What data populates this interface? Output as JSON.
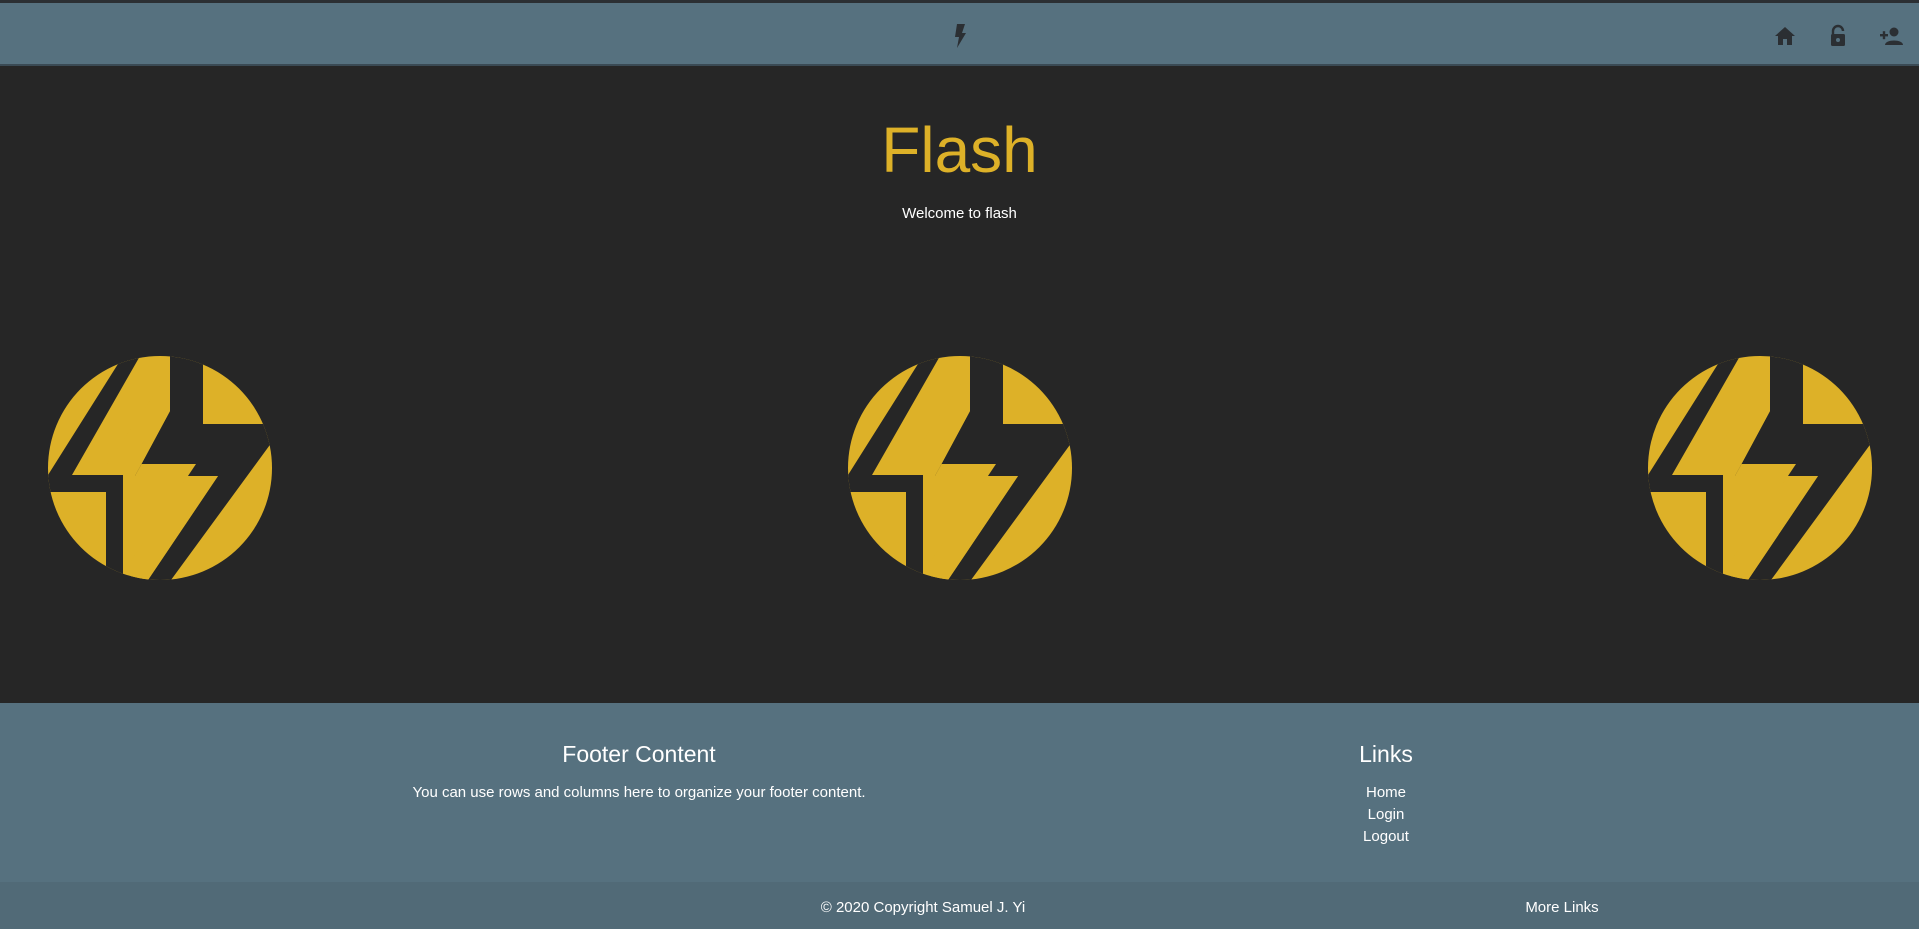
{
  "navbar": {
    "brand_icon": "flash-bolt-icon",
    "icons": [
      "home-icon",
      "lock-open-icon",
      "person-add-icon"
    ],
    "icon_color": "#2b2f33",
    "background": "#56717f"
  },
  "hero": {
    "title": "Flash",
    "subtitle": "Welcome to flash",
    "title_color": "#ddb128",
    "logos": [
      "flash-logo-icon",
      "flash-logo-icon",
      "flash-logo-icon"
    ],
    "logo_color": "#ddb128"
  },
  "footer": {
    "content_heading": "Footer Content",
    "content_text": "You can use rows and columns here to organize your footer content.",
    "links_heading": "Links",
    "links": [
      "Home",
      "Login",
      "Logout"
    ],
    "copyright": "© 2020 Copyright Samuel J. Yi",
    "more_links": "More Links"
  }
}
